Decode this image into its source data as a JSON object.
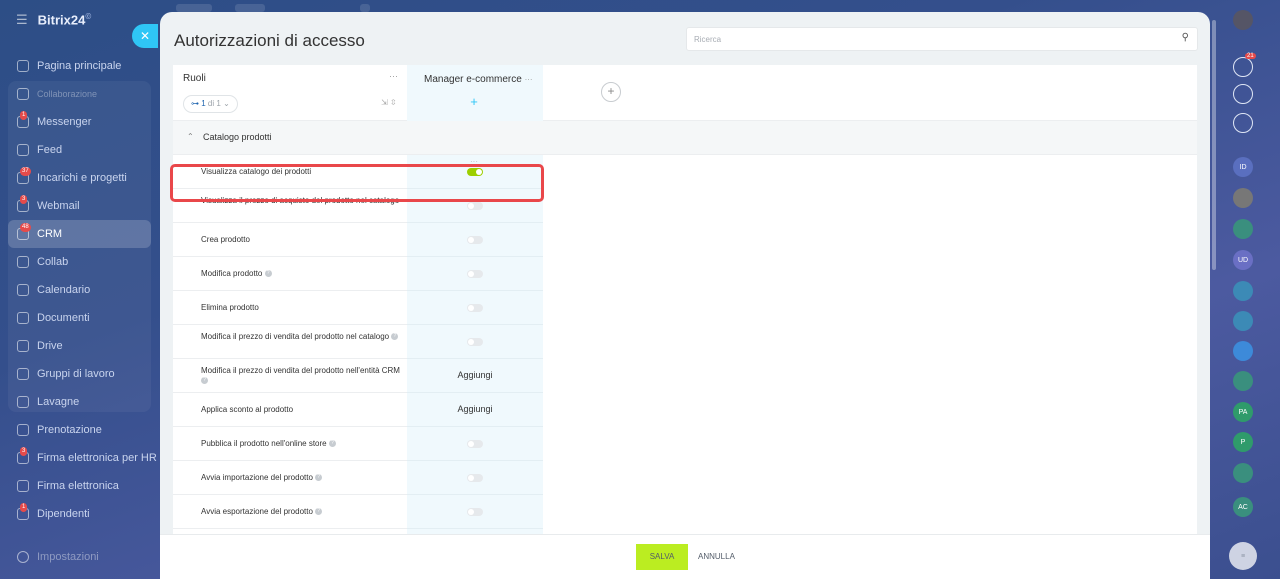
{
  "app": {
    "name": "Bitrix24",
    "name_sup": "©"
  },
  "sidebar": {
    "items": [
      {
        "label": "Pagina principale",
        "icon": "home-icon",
        "badge": ""
      },
      {
        "label": "Collaborazione",
        "icon": "collab-group-icon",
        "badge": ""
      },
      {
        "label": "Messenger",
        "icon": "chat-icon",
        "badge": "1"
      },
      {
        "label": "Feed",
        "icon": "feed-icon",
        "badge": ""
      },
      {
        "label": "Incarichi e progetti",
        "icon": "tasks-icon",
        "badge": "37"
      },
      {
        "label": "Webmail",
        "icon": "mail-icon",
        "badge": "3"
      },
      {
        "label": "CRM",
        "icon": "crm-icon",
        "badge": "48"
      },
      {
        "label": "Collab",
        "icon": "collab-icon",
        "badge": ""
      },
      {
        "label": "Calendario",
        "icon": "calendar-icon",
        "badge": ""
      },
      {
        "label": "Documenti",
        "icon": "documents-icon",
        "badge": ""
      },
      {
        "label": "Drive",
        "icon": "drive-icon",
        "badge": ""
      },
      {
        "label": "Gruppi di lavoro",
        "icon": "groups-icon",
        "badge": ""
      },
      {
        "label": "Lavagne",
        "icon": "boards-icon",
        "badge": ""
      },
      {
        "label": "Prenotazione",
        "icon": "booking-icon",
        "badge": ""
      },
      {
        "label": "Firma elettronica per HR",
        "icon": "hr-sign-icon",
        "badge": "3"
      },
      {
        "label": "Firma elettronica",
        "icon": "sign-icon",
        "badge": ""
      },
      {
        "label": "Dipendenti",
        "icon": "employees-icon",
        "badge": "1"
      }
    ],
    "settings_label": "Impostazioni"
  },
  "panel": {
    "title": "Autorizzazioni di accesso",
    "search_placeholder": "Ricerca"
  },
  "roles": {
    "label": "Ruoli",
    "pager_current": "1",
    "pager_total": "di 1",
    "column_name": "Manager e-commerce"
  },
  "section": {
    "label": "Catalogo prodotti"
  },
  "permissions": [
    {
      "label": "Visualizza catalogo dei prodotti",
      "help": false,
      "value": "on"
    },
    {
      "label": "Visualizza il prezzo di acquisto del prodotto nel catalogo",
      "help": false,
      "value": "off"
    },
    {
      "label": "Crea prodotto",
      "help": false,
      "value": "off"
    },
    {
      "label": "Modifica prodotto",
      "help": true,
      "value": "off"
    },
    {
      "label": "Elimina prodotto",
      "help": false,
      "value": "off"
    },
    {
      "label": "Modifica il prezzo di vendita del prodotto nel catalogo",
      "help": true,
      "value": "off"
    },
    {
      "label": "Modifica il prezzo di vendita del prodotto nell'entità CRM",
      "help": true,
      "value": "Aggiungi"
    },
    {
      "label": "Applica sconto al prodotto",
      "help": false,
      "value": "Aggiungi"
    },
    {
      "label": "Pubblica il prodotto nell'online store",
      "help": true,
      "value": "off"
    },
    {
      "label": "Avvia importazione del prodotto",
      "help": true,
      "value": "off"
    },
    {
      "label": "Avvia esportazione del prodotto",
      "help": true,
      "value": "off"
    }
  ],
  "footer": {
    "save_label": "SALVA",
    "cancel_label": "ANNULLA"
  },
  "right_sidebar": {
    "notifications_badge": "21",
    "avatars": [
      "ID",
      "UD",
      "PA",
      "P",
      "AC"
    ]
  },
  "colors": {
    "accent": "#2fc6f6",
    "toggle_on": "#9dcf00",
    "save": "#bbed21",
    "highlight": "#e9474a"
  }
}
